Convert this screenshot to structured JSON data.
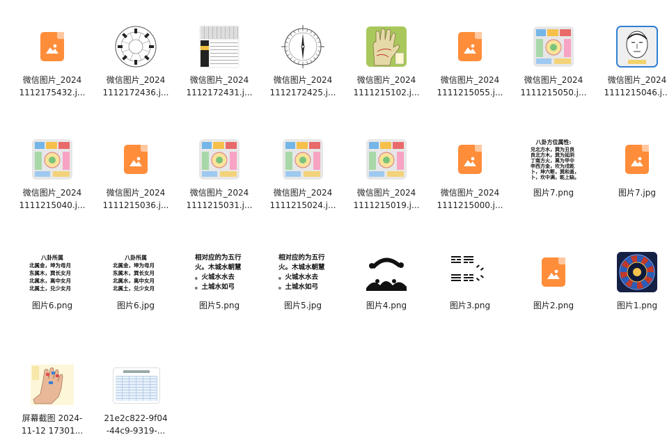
{
  "files": [
    {
      "name_l1": "微信图片_2024",
      "name_l2": "1112175432.j...",
      "thumb": "orange-image-icon"
    },
    {
      "name_l1": "微信图片_2024",
      "name_l2": "1112172436.j...",
      "thumb": "bagua-compass"
    },
    {
      "name_l1": "微信图片_2024",
      "name_l2": "1112172431.j...",
      "thumb": "table-sheet"
    },
    {
      "name_l1": "微信图片_2024",
      "name_l2": "1112172425.j...",
      "thumb": "compass-needle"
    },
    {
      "name_l1": "微信图片_2024",
      "name_l2": "1111215102.j...",
      "thumb": "palm-green"
    },
    {
      "name_l1": "微信图片_2024",
      "name_l2": "1111215055.j...",
      "thumb": "orange-image-icon"
    },
    {
      "name_l1": "微信图片_2024",
      "name_l2": "1111215050.j...",
      "thumb": "colorful-chart"
    },
    {
      "name_l1": "微信图片_2024",
      "name_l2": "1111215046.j...",
      "thumb": "face-sketch"
    },
    {
      "name_l1": "微信图片_2024",
      "name_l2": "1111215040.j...",
      "thumb": "colorful-chart"
    },
    {
      "name_l1": "微信图片_2024",
      "name_l2": "1111215036.j...",
      "thumb": "orange-image-icon"
    },
    {
      "name_l1": "微信图片_2024",
      "name_l2": "1111215031.j...",
      "thumb": "colorful-chart"
    },
    {
      "name_l1": "微信图片_2024",
      "name_l2": "1111215024.j...",
      "thumb": "colorful-chart"
    },
    {
      "name_l1": "微信图片_2024",
      "name_l2": "1111215019.j...",
      "thumb": "colorful-chart"
    },
    {
      "name_l1": "微信图片_2024",
      "name_l2": "1111215000.j...",
      "thumb": "orange-image-icon"
    },
    {
      "name_l1": "图片7.png",
      "name_l2": "",
      "thumb": "text-bagua"
    },
    {
      "name_l1": "图片7.jpg",
      "name_l2": "",
      "thumb": "orange-image-icon"
    },
    {
      "name_l1": "图片6.png",
      "name_l2": "",
      "thumb": "text-bagua-2"
    },
    {
      "name_l1": "图片6.jpg",
      "name_l2": "",
      "thumb": "text-bagua-2"
    },
    {
      "name_l1": "图片5.png",
      "name_l2": "",
      "thumb": "text-wuxing"
    },
    {
      "name_l1": "图片5.jpg",
      "name_l2": "",
      "thumb": "text-wuxing"
    },
    {
      "name_l1": "图片4.png",
      "name_l2": "",
      "thumb": "black-shapes"
    },
    {
      "name_l1": "图片3.png",
      "name_l2": "",
      "thumb": "trigrams"
    },
    {
      "name_l1": "图片2.png",
      "name_l2": "",
      "thumb": "orange-image-icon"
    },
    {
      "name_l1": "图片1.png",
      "name_l2": "",
      "thumb": "dark-wheel"
    },
    {
      "name_l1": "屏幕截图 2024-",
      "name_l2": "11-12 17301...",
      "thumb": "hand-yellow"
    },
    {
      "name_l1": "21e2c822-9f04",
      "name_l2": "-44c9-9319-...",
      "thumb": "table-blue"
    }
  ],
  "thumb_text": {
    "bagua_title": "八卦方位属性:",
    "bagua_lines": [
      "兑北方水，巽为丑良",
      "良北方木，巽为延阴",
      "丁南方火，离为甲中",
      "申西方金，坎为戌乾",
      "卜，坤六断，巽和盖，",
      "卜，坎中满，乾上缺。"
    ],
    "bagua2_title": "八卦所属",
    "bagua2_lines": [
      "北属金，坤为母月",
      "东属木，巽长女月",
      "北属水，离中女月",
      "北属土，兑少女月"
    ],
    "wuxing_lines": [
      "相对应的为五行",
      "火。木城水朝慧",
      "。火城水水去",
      "。土城水如弓"
    ]
  },
  "colors": {
    "orange_icon": "#ff8d3a",
    "label_text": "#1f1f1f",
    "background": "#ffffff"
  }
}
